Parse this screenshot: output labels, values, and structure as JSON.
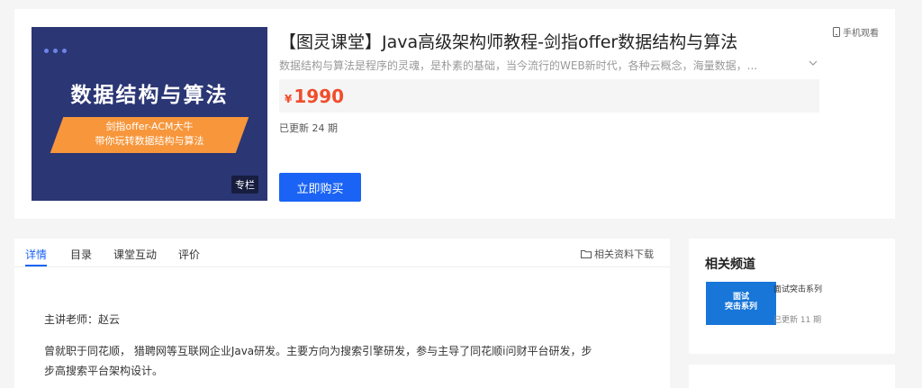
{
  "course": {
    "title": "【图灵课堂】Java高级架构师教程-剑指offer数据结构与算法",
    "mobile_view_label": "手机观看",
    "description": "数据结构与算法是程序的灵魂，是朴素的基础，当今流行的WEB新时代，各种云概念，海量数据，...",
    "price_currency": "¥",
    "price": "1990",
    "updated": "已更新 24 期",
    "buy_label": "立即购买"
  },
  "cover": {
    "title": "数据结构与算法",
    "subtitle_line1": "剑指offer-ACM大牛",
    "subtitle_line2": "带你玩转数据结构与算法",
    "tag": "专栏"
  },
  "tabs": [
    {
      "label": "详情",
      "active": true
    },
    {
      "label": "目录",
      "active": false
    },
    {
      "label": "课堂互动",
      "active": false
    },
    {
      "label": "评价",
      "active": false
    }
  ],
  "download_label": "相关资料下载",
  "detail": {
    "teacher": "主讲老师：赵云",
    "bio": "曾就职于同花顺， 猎聘网等互联网企业Java研发。主要方向为搜索引擎研发，参与主导了同花顺i问财平台研发，步步高搜索平台架构设计。"
  },
  "related": {
    "title": "相关频道",
    "items": [
      {
        "thumb_text_line1": "面试",
        "thumb_text_line2": "突击系列",
        "name": "面试突击系列",
        "updated": "已更新 11 期"
      }
    ]
  },
  "colors": {
    "accent": "#1a63f5",
    "price": "#f04d2c",
    "cover_bg": "#2b3674",
    "cover_banner": "#f7963b"
  },
  "icons": [
    "phone-icon",
    "chevron-down-icon",
    "folder-icon"
  ]
}
